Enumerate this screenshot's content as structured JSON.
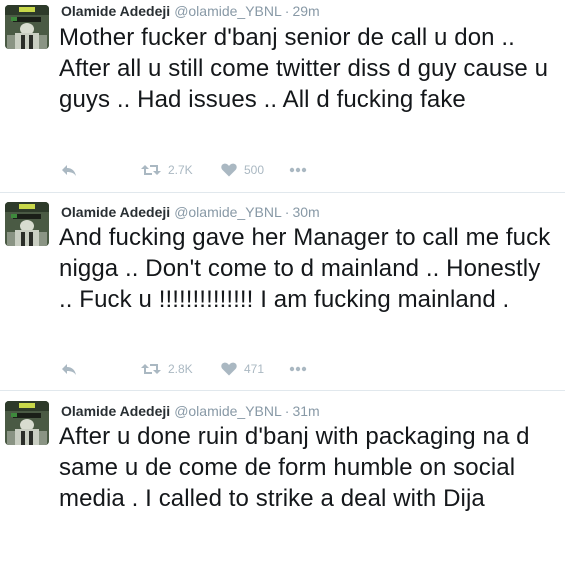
{
  "tweets": [
    {
      "fullname": "Olamide Adedeji",
      "username": "@olamide_YBNL",
      "sep": "·",
      "time": "29m",
      "text": "Mother fucker d'banj senior de call u don .. After all u still come twitter diss d guy cause u guys .. Had issues .. All d fucking fake",
      "retweets": "2.7K",
      "likes": "500",
      "icons": {
        "reply": "reply-icon",
        "retweet": "retweet-icon",
        "like": "heart-icon",
        "more": "more-icon"
      }
    },
    {
      "fullname": "Olamide Adedeji",
      "username": "@olamide_YBNL",
      "sep": "·",
      "time": "30m",
      "text": "And fucking gave her Manager to call me fuck nigga .. Don't come to d mainland .. Honestly .. Fuck u !!!!!!!!!!!!!!  I am fucking mainland .",
      "retweets": "2.8K",
      "likes": "471",
      "icons": {
        "reply": "reply-icon",
        "retweet": "retweet-icon",
        "like": "heart-icon",
        "more": "more-icon"
      }
    },
    {
      "fullname": "Olamide Adedeji",
      "username": "@olamide_YBNL",
      "sep": "·",
      "time": "31m",
      "text": "After u done ruin d'banj with packaging na d same u de come de form humble on social media . I called to strike a deal with Dija"
    }
  ],
  "colors": {
    "name": "#292f33",
    "muted": "#8899a6",
    "action": "#aab8c2",
    "divider": "#e1e8ed"
  }
}
